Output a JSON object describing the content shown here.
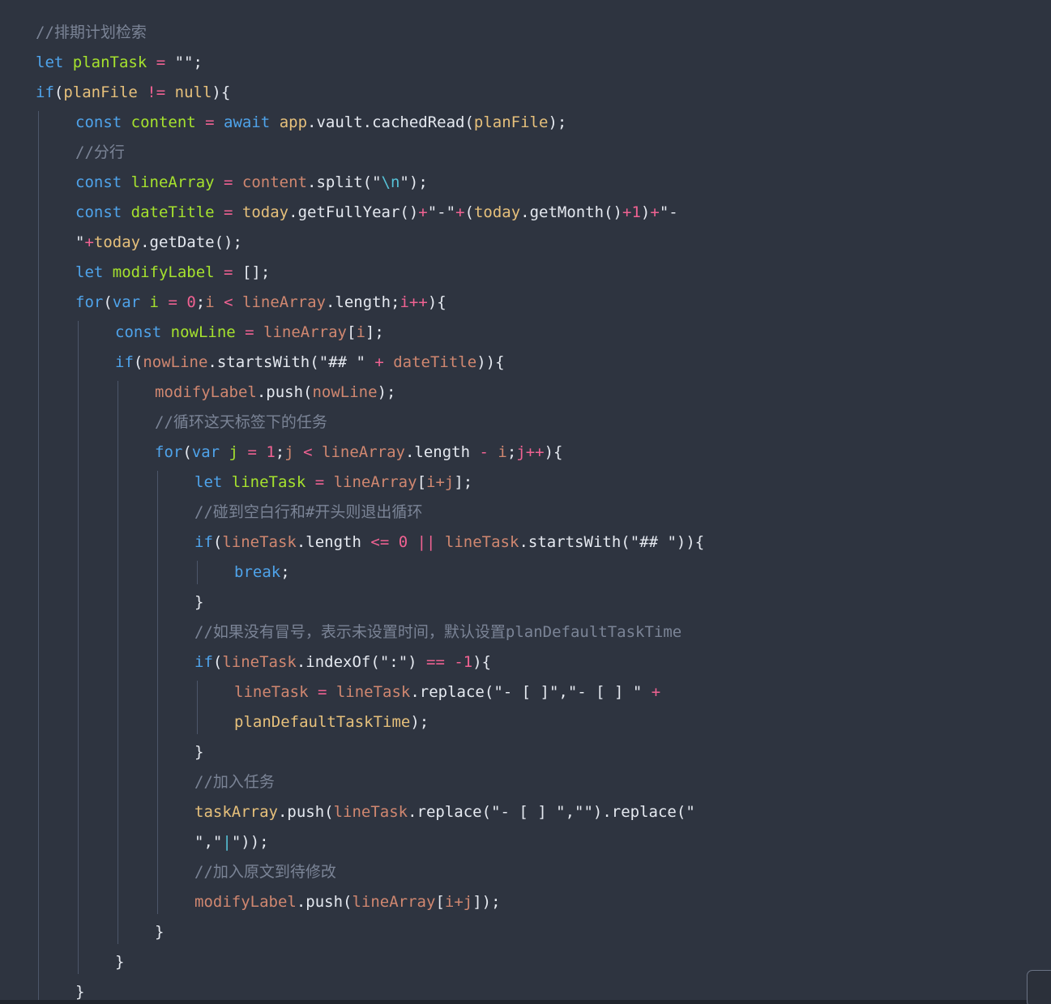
{
  "editor": {
    "colors": {
      "background": "#2e3440",
      "comment": "#7b8496",
      "keyword": "#4fa3ea",
      "variable": "#a6e22e",
      "property": "#d08770",
      "operator": "#f06292",
      "string": "#e5e9f0",
      "escape": "#56c1d6",
      "number": "#f06292",
      "plain": "#e5e9f0",
      "constant_identifier": "#e6c07b"
    },
    "lines": [
      {
        "indent": 0,
        "tokens": [
          {
            "t": "//排期计划检索",
            "k": "comment"
          }
        ]
      },
      {
        "indent": 0,
        "tokens": [
          {
            "t": "let ",
            "k": "keyword"
          },
          {
            "t": "planTask",
            "k": "variable"
          },
          {
            "t": " = ",
            "k": "operator"
          },
          {
            "t": "\"\"",
            "k": "string"
          },
          {
            "t": ";",
            "k": "plain"
          }
        ]
      },
      {
        "indent": 0,
        "tokens": [
          {
            "t": "if",
            "k": "keyword"
          },
          {
            "t": "(",
            "k": "plain"
          },
          {
            "t": "planFile",
            "k": "constant_identifier"
          },
          {
            "t": " != ",
            "k": "operator"
          },
          {
            "t": "null",
            "k": "constant_identifier"
          },
          {
            "t": "){",
            "k": "plain"
          }
        ]
      },
      {
        "indent": 1,
        "tokens": [
          {
            "t": "const ",
            "k": "keyword"
          },
          {
            "t": "content",
            "k": "variable"
          },
          {
            "t": " = ",
            "k": "operator"
          },
          {
            "t": "await ",
            "k": "keyword"
          },
          {
            "t": "app",
            "k": "constant_identifier"
          },
          {
            "t": ".vault.cachedRead(",
            "k": "plain"
          },
          {
            "t": "planFile",
            "k": "constant_identifier"
          },
          {
            "t": ");",
            "k": "plain"
          }
        ]
      },
      {
        "indent": 1,
        "tokens": [
          {
            "t": "//分行",
            "k": "comment"
          }
        ]
      },
      {
        "indent": 1,
        "tokens": [
          {
            "t": "const ",
            "k": "keyword"
          },
          {
            "t": "lineArray",
            "k": "variable"
          },
          {
            "t": " = ",
            "k": "operator"
          },
          {
            "t": "content",
            "k": "property"
          },
          {
            "t": ".split(",
            "k": "plain"
          },
          {
            "t": "\"",
            "k": "string"
          },
          {
            "t": "\\n",
            "k": "escape"
          },
          {
            "t": "\"",
            "k": "string"
          },
          {
            "t": ");",
            "k": "plain"
          }
        ]
      },
      {
        "indent": 1,
        "tokens": [
          {
            "t": "const ",
            "k": "keyword"
          },
          {
            "t": "dateTitle",
            "k": "variable"
          },
          {
            "t": " = ",
            "k": "operator"
          },
          {
            "t": "today",
            "k": "constant_identifier"
          },
          {
            "t": ".getFullYear()",
            "k": "plain"
          },
          {
            "t": "+",
            "k": "operator"
          },
          {
            "t": "\"-\"",
            "k": "string"
          },
          {
            "t": "+",
            "k": "operator"
          },
          {
            "t": "(",
            "k": "plain"
          },
          {
            "t": "today",
            "k": "constant_identifier"
          },
          {
            "t": ".getMonth()",
            "k": "plain"
          },
          {
            "t": "+1",
            "k": "number"
          },
          {
            "t": ")",
            "k": "plain"
          },
          {
            "t": "+",
            "k": "operator"
          },
          {
            "t": "\"-",
            "k": "string"
          }
        ]
      },
      {
        "indent": 1,
        "tokens": [
          {
            "t": "\"",
            "k": "string"
          },
          {
            "t": "+",
            "k": "operator"
          },
          {
            "t": "today",
            "k": "constant_identifier"
          },
          {
            "t": ".getDate();",
            "k": "plain"
          }
        ]
      },
      {
        "indent": 1,
        "tokens": [
          {
            "t": "let ",
            "k": "keyword"
          },
          {
            "t": "modifyLabel",
            "k": "variable"
          },
          {
            "t": " = ",
            "k": "operator"
          },
          {
            "t": "[];",
            "k": "plain"
          }
        ]
      },
      {
        "indent": 1,
        "tokens": [
          {
            "t": "for",
            "k": "keyword"
          },
          {
            "t": "(",
            "k": "plain"
          },
          {
            "t": "var ",
            "k": "keyword"
          },
          {
            "t": "i",
            "k": "variable"
          },
          {
            "t": " = ",
            "k": "operator"
          },
          {
            "t": "0",
            "k": "number"
          },
          {
            "t": ";",
            "k": "plain"
          },
          {
            "t": "i",
            "k": "property"
          },
          {
            "t": " < ",
            "k": "operator"
          },
          {
            "t": "lineArray",
            "k": "property"
          },
          {
            "t": ".length;",
            "k": "plain"
          },
          {
            "t": "i++",
            "k": "operator"
          },
          {
            "t": "){",
            "k": "plain"
          }
        ]
      },
      {
        "indent": 2,
        "tokens": [
          {
            "t": "const ",
            "k": "keyword"
          },
          {
            "t": "nowLine",
            "k": "variable"
          },
          {
            "t": " = ",
            "k": "operator"
          },
          {
            "t": "lineArray",
            "k": "property"
          },
          {
            "t": "[",
            "k": "plain"
          },
          {
            "t": "i",
            "k": "property"
          },
          {
            "t": "];",
            "k": "plain"
          }
        ]
      },
      {
        "indent": 2,
        "tokens": [
          {
            "t": "if",
            "k": "keyword"
          },
          {
            "t": "(",
            "k": "plain"
          },
          {
            "t": "nowLine",
            "k": "property"
          },
          {
            "t": ".startsWith(",
            "k": "plain"
          },
          {
            "t": "\"## \"",
            "k": "string"
          },
          {
            "t": " + ",
            "k": "operator"
          },
          {
            "t": "dateTitle",
            "k": "property"
          },
          {
            "t": ")){",
            "k": "plain"
          }
        ]
      },
      {
        "indent": 3,
        "tokens": [
          {
            "t": "modifyLabel",
            "k": "property"
          },
          {
            "t": ".push(",
            "k": "plain"
          },
          {
            "t": "nowLine",
            "k": "property"
          },
          {
            "t": ");",
            "k": "plain"
          }
        ]
      },
      {
        "indent": 3,
        "tokens": [
          {
            "t": "//循环这天标签下的任务",
            "k": "comment"
          }
        ]
      },
      {
        "indent": 3,
        "tokens": [
          {
            "t": "for",
            "k": "keyword"
          },
          {
            "t": "(",
            "k": "plain"
          },
          {
            "t": "var ",
            "k": "keyword"
          },
          {
            "t": "j",
            "k": "variable"
          },
          {
            "t": " = ",
            "k": "operator"
          },
          {
            "t": "1",
            "k": "number"
          },
          {
            "t": ";",
            "k": "plain"
          },
          {
            "t": "j",
            "k": "property"
          },
          {
            "t": " < ",
            "k": "operator"
          },
          {
            "t": "lineArray",
            "k": "property"
          },
          {
            "t": ".length",
            "k": "plain"
          },
          {
            "t": " - ",
            "k": "operator"
          },
          {
            "t": "i",
            "k": "property"
          },
          {
            "t": ";",
            "k": "plain"
          },
          {
            "t": "j++",
            "k": "operator"
          },
          {
            "t": "){",
            "k": "plain"
          }
        ]
      },
      {
        "indent": 4,
        "tokens": [
          {
            "t": "let ",
            "k": "keyword"
          },
          {
            "t": "lineTask",
            "k": "variable"
          },
          {
            "t": " = ",
            "k": "operator"
          },
          {
            "t": "lineArray",
            "k": "property"
          },
          {
            "t": "[",
            "k": "plain"
          },
          {
            "t": "i+j",
            "k": "property"
          },
          {
            "t": "];",
            "k": "plain"
          }
        ]
      },
      {
        "indent": 4,
        "tokens": [
          {
            "t": "//碰到空白行和#开头则退出循环",
            "k": "comment"
          }
        ]
      },
      {
        "indent": 4,
        "tokens": [
          {
            "t": "if",
            "k": "keyword"
          },
          {
            "t": "(",
            "k": "plain"
          },
          {
            "t": "lineTask",
            "k": "property"
          },
          {
            "t": ".length",
            "k": "plain"
          },
          {
            "t": " <= ",
            "k": "operator"
          },
          {
            "t": "0",
            "k": "number"
          },
          {
            "t": " || ",
            "k": "operator"
          },
          {
            "t": "lineTask",
            "k": "property"
          },
          {
            "t": ".startsWith(",
            "k": "plain"
          },
          {
            "t": "\"## \"",
            "k": "string"
          },
          {
            "t": ")){",
            "k": "plain"
          }
        ]
      },
      {
        "indent": 5,
        "tokens": [
          {
            "t": "break",
            "k": "keyword"
          },
          {
            "t": ";",
            "k": "plain"
          }
        ]
      },
      {
        "indent": 4,
        "tokens": [
          {
            "t": "}",
            "k": "plain"
          }
        ]
      },
      {
        "indent": 4,
        "tokens": [
          {
            "t": "//如果没有冒号，表示未设置时间，默认设置planDefaultTaskTime",
            "k": "comment"
          }
        ]
      },
      {
        "indent": 4,
        "tokens": [
          {
            "t": "if",
            "k": "keyword"
          },
          {
            "t": "(",
            "k": "plain"
          },
          {
            "t": "lineTask",
            "k": "property"
          },
          {
            "t": ".indexOf(",
            "k": "plain"
          },
          {
            "t": "\":\"",
            "k": "string"
          },
          {
            "t": ") ",
            "k": "plain"
          },
          {
            "t": "== -1",
            "k": "operator"
          },
          {
            "t": "){",
            "k": "plain"
          }
        ]
      },
      {
        "indent": 5,
        "tokens": [
          {
            "t": "lineTask",
            "k": "property"
          },
          {
            "t": " = ",
            "k": "operator"
          },
          {
            "t": "lineTask",
            "k": "property"
          },
          {
            "t": ".replace(",
            "k": "plain"
          },
          {
            "t": "\"- [ ]\"",
            "k": "string"
          },
          {
            "t": ",",
            "k": "plain"
          },
          {
            "t": "\"- [ ] \"",
            "k": "string"
          },
          {
            "t": " +",
            "k": "operator"
          }
        ]
      },
      {
        "indent": 5,
        "tokens": [
          {
            "t": "planDefaultTaskTime",
            "k": "constant_identifier"
          },
          {
            "t": ");",
            "k": "plain"
          }
        ]
      },
      {
        "indent": 4,
        "tokens": [
          {
            "t": "}",
            "k": "plain"
          }
        ]
      },
      {
        "indent": 4,
        "tokens": [
          {
            "t": "//加入任务",
            "k": "comment"
          }
        ]
      },
      {
        "indent": 4,
        "tokens": [
          {
            "t": "taskArray",
            "k": "constant_identifier"
          },
          {
            "t": ".push(",
            "k": "plain"
          },
          {
            "t": "lineTask",
            "k": "property"
          },
          {
            "t": ".replace(",
            "k": "plain"
          },
          {
            "t": "\"- [ ] \"",
            "k": "string"
          },
          {
            "t": ",",
            "k": "plain"
          },
          {
            "t": "\"\"",
            "k": "string"
          },
          {
            "t": ").replace(",
            "k": "plain"
          },
          {
            "t": "\"",
            "k": "string"
          }
        ]
      },
      {
        "indent": 4,
        "tokens": [
          {
            "t": "\"",
            "k": "string"
          },
          {
            "t": ",",
            "k": "plain"
          },
          {
            "t": "\"",
            "k": "string"
          },
          {
            "t": "|",
            "k": "escape"
          },
          {
            "t": "\"",
            "k": "string"
          },
          {
            "t": "));",
            "k": "plain"
          }
        ]
      },
      {
        "indent": 4,
        "tokens": [
          {
            "t": "//加入原文到待修改",
            "k": "comment"
          }
        ]
      },
      {
        "indent": 4,
        "tokens": [
          {
            "t": "modifyLabel",
            "k": "property"
          },
          {
            "t": ".push(",
            "k": "plain"
          },
          {
            "t": "lineArray",
            "k": "property"
          },
          {
            "t": "[",
            "k": "plain"
          },
          {
            "t": "i+j",
            "k": "property"
          },
          {
            "t": "]);",
            "k": "plain"
          }
        ]
      },
      {
        "indent": 3,
        "tokens": [
          {
            "t": "}",
            "k": "plain"
          }
        ]
      },
      {
        "indent": 2,
        "tokens": [
          {
            "t": "}",
            "k": "plain"
          }
        ]
      },
      {
        "indent": 1,
        "tokens": [
          {
            "t": "}",
            "k": "plain"
          }
        ]
      }
    ]
  }
}
